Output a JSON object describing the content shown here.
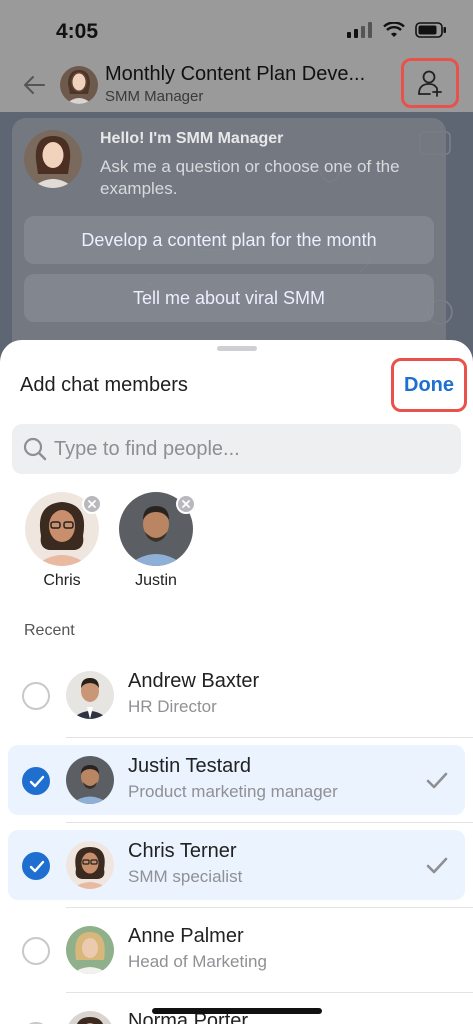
{
  "status": {
    "time": "4:05"
  },
  "header": {
    "title": "Monthly Content Plan Deve...",
    "subtitle": "SMM Manager"
  },
  "chat": {
    "greeting": "Hello! I'm SMM Manager",
    "prompt": "Ask me a question or choose one of the examples.",
    "examples": [
      "Develop a content plan for the month",
      "Tell me about viral SMM"
    ]
  },
  "sheet": {
    "title": "Add chat members",
    "done_label": "Done",
    "search_placeholder": "Type to find people...",
    "selected_chips": [
      {
        "name": "Chris"
      },
      {
        "name": "Justin"
      }
    ],
    "recent_label": "Recent",
    "people": [
      {
        "name": "Andrew Baxter",
        "role": "HR Director",
        "selected": false
      },
      {
        "name": "Justin Testard",
        "role": "Product marketing manager",
        "selected": true
      },
      {
        "name": "Chris Terner",
        "role": "SMM specialist",
        "selected": true
      },
      {
        "name": "Anne Palmer",
        "role": "Head of Marketing",
        "selected": false
      },
      {
        "name": "Norma Porter",
        "role": "",
        "selected": false
      }
    ]
  },
  "colors": {
    "accent": "#1f6fd1",
    "highlight_border": "#e8524a",
    "selected_row": "#eaf3fe"
  }
}
